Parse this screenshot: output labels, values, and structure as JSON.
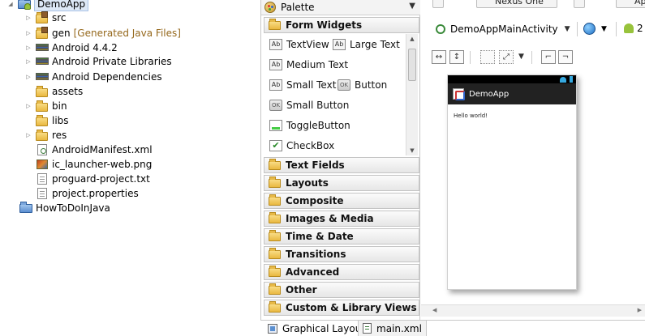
{
  "explorer": {
    "project": "DemoApp",
    "items": [
      {
        "label": "src",
        "deco": ""
      },
      {
        "label": "gen",
        "deco": "[Generated Java Files]"
      },
      {
        "label": "Android 4.4.2",
        "deco": ""
      },
      {
        "label": "Android Private Libraries",
        "deco": ""
      },
      {
        "label": "Android Dependencies",
        "deco": ""
      },
      {
        "label": "assets",
        "deco": ""
      },
      {
        "label": "bin",
        "deco": ""
      },
      {
        "label": "libs",
        "deco": ""
      },
      {
        "label": "res",
        "deco": ""
      },
      {
        "label": "AndroidManifest.xml",
        "deco": ""
      },
      {
        "label": "ic_launcher-web.png",
        "deco": ""
      },
      {
        "label": "proguard-project.txt",
        "deco": ""
      },
      {
        "label": "project.properties",
        "deco": ""
      }
    ],
    "second_project": "HowToDoInJava"
  },
  "palette": {
    "title": "Palette",
    "open_category": "Form Widgets",
    "form_widgets": [
      "TextView",
      "Large Text",
      "Medium Text",
      "Small Text",
      "Button",
      "Small Button",
      "ToggleButton",
      "CheckBox"
    ],
    "widget_icons": {
      "ab": "Ab",
      "ok": "OK"
    },
    "categories": [
      "Text Fields",
      "Layouts",
      "Composite",
      "Images & Media",
      "Time & Date",
      "Transitions",
      "Advanced",
      "Other",
      "Custom & Library Views"
    ]
  },
  "editor": {
    "top_tabs": [
      "Nexus One",
      "Ap"
    ],
    "activity": "DemoAppMainActivity",
    "api_level": "2",
    "device_preview": {
      "app_title": "DemoApp",
      "content_text": "Hello world!"
    }
  },
  "tabs": {
    "graphical": "Graphical Layout",
    "xml": "main.xml"
  },
  "colors": {
    "selection": "#dde8f6",
    "folder": "#e9b840",
    "android_green": "#98c33c",
    "status_blue": "#36a9e0"
  }
}
